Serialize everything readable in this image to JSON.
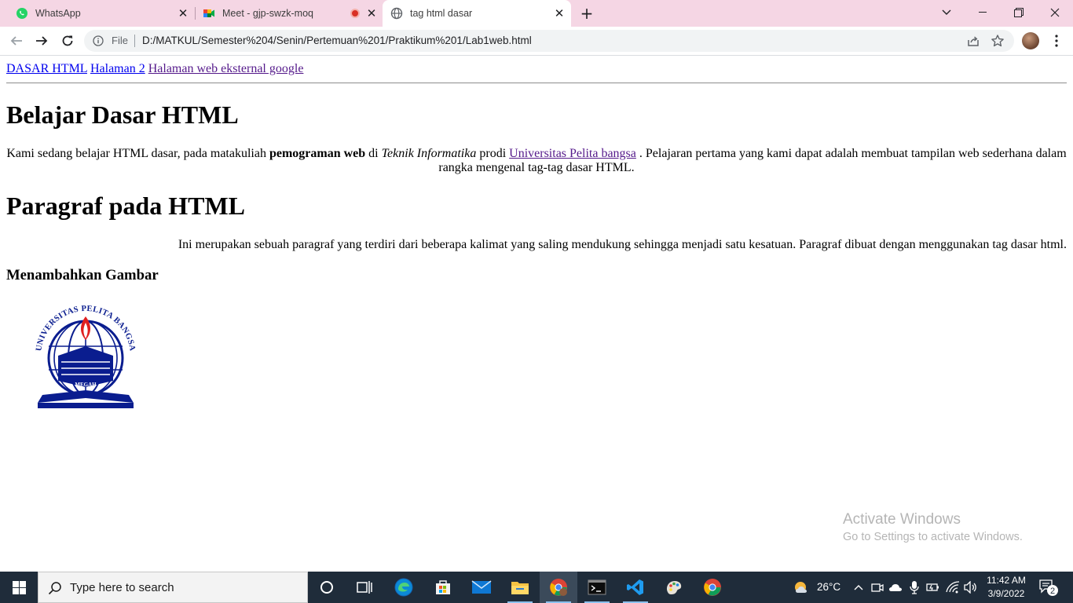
{
  "browser": {
    "tabs": [
      {
        "title": "WhatsApp",
        "icon": "whatsapp-icon"
      },
      {
        "title": "Meet - gjp-swzk-moq",
        "icon": "google-meet-icon",
        "recording": true
      },
      {
        "title": "tag html dasar",
        "icon": "globe-icon",
        "active": true
      }
    ],
    "address": {
      "scheme_label": "File",
      "url": "D:/MATKUL/Semester%204/Senin/Pertemuan%201/Praktikum%201/Lab1web.html"
    }
  },
  "page": {
    "nav_links": [
      "DASAR HTML",
      "Halaman 2",
      "Halaman web eksternal google"
    ],
    "heading1": "Belajar Dasar HTML",
    "para1": {
      "text_a": "Kami sedang belajar HTML dasar, pada matakuliah ",
      "bold": "pemograman web",
      "text_b": " di ",
      "italic": "Teknik Informatika",
      "text_c": " prodi ",
      "link": "Universitas Pelita bangsa",
      "text_d": " . Pelajaran pertama yang kami dapat adalah membuat tampilan web sederhana dalam rangka mengenal tag-tag dasar HTML."
    },
    "heading2": "Paragraf pada HTML",
    "para2": "Ini merupakan sebuah paragraf yang terdiri dari beberapa kalimat yang saling mendukung sehingga menjadi satu kesatuan. Paragraf dibuat dengan menggunakan tag dasar html.",
    "heading3": "Menambahkan Gambar",
    "logo": {
      "ring_text": "UNIVERSITAS PELITA BANGSA",
      "motto": "MEGAH",
      "color": "#0a1d8f",
      "flame_color": "#e02020"
    }
  },
  "watermark": {
    "line1": "Activate Windows",
    "line2": "Go to Settings to activate Windows."
  },
  "taskbar": {
    "search_placeholder": "Type here to search",
    "apps": [
      "cortana-icon",
      "task-view-icon",
      "edge-icon",
      "store-icon",
      "mail-icon",
      "file-explorer-icon",
      "chrome-profile-icon",
      "terminal-icon",
      "vscode-icon",
      "paint-icon",
      "chrome-icon"
    ],
    "weather": "26°C",
    "time": "11:42 AM",
    "date": "3/9/2022",
    "notifications": "2"
  }
}
